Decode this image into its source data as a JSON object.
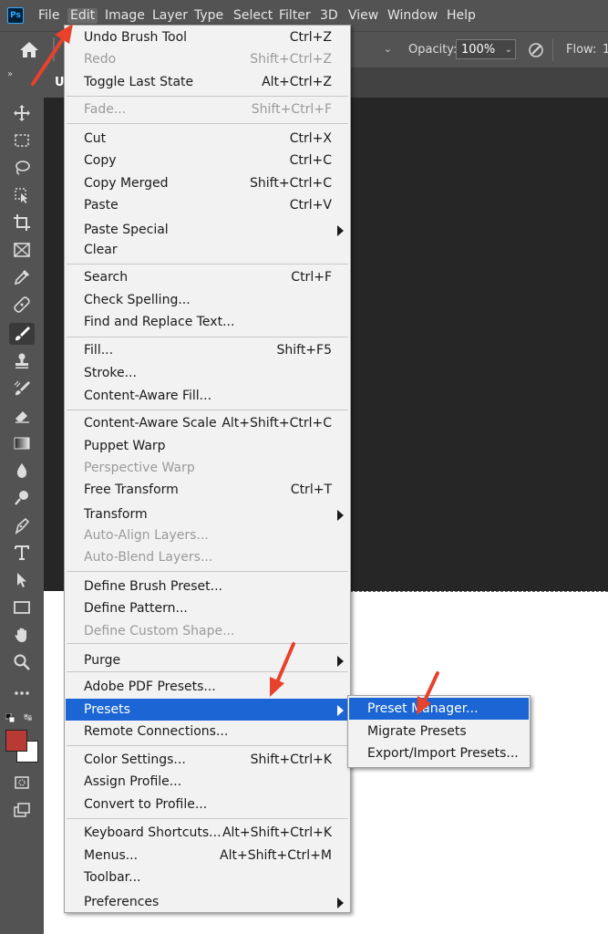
{
  "app": {
    "logo_text": "Ps"
  },
  "menubar": {
    "items": [
      "File",
      "Edit",
      "Image",
      "Layer",
      "Type",
      "Select",
      "Filter",
      "3D",
      "View",
      "Window",
      "Help"
    ],
    "active": "Edit"
  },
  "options_bar": {
    "opacity_label": "Opacity:",
    "opacity_value": "100%",
    "flow_label": "Flow:",
    "flow_value": "1"
  },
  "toolbar": {
    "collapse_glyph": "»"
  },
  "document": {
    "tab_initial": "U"
  },
  "edit_menu": {
    "items": [
      {
        "label": "Undo Brush Tool",
        "shortcut": "Ctrl+Z",
        "disabled": false
      },
      {
        "label": "Redo",
        "shortcut": "Shift+Ctrl+Z",
        "disabled": true
      },
      {
        "label": "Toggle Last State",
        "shortcut": "Alt+Ctrl+Z",
        "disabled": false
      },
      {
        "label": "Fade...",
        "shortcut": "Shift+Ctrl+F",
        "disabled": true
      },
      {
        "label": "Cut",
        "shortcut": "Ctrl+X",
        "disabled": false
      },
      {
        "label": "Copy",
        "shortcut": "Ctrl+C",
        "disabled": false
      },
      {
        "label": "Copy Merged",
        "shortcut": "Shift+Ctrl+C",
        "disabled": false
      },
      {
        "label": "Paste",
        "shortcut": "Ctrl+V",
        "disabled": false
      },
      {
        "label": "Paste Special",
        "shortcut": "",
        "disabled": false,
        "submenu": true
      },
      {
        "label": "Clear",
        "shortcut": "",
        "disabled": false
      },
      {
        "label": "Search",
        "shortcut": "Ctrl+F",
        "disabled": false
      },
      {
        "label": "Check Spelling...",
        "shortcut": "",
        "disabled": false
      },
      {
        "label": "Find and Replace Text...",
        "shortcut": "",
        "disabled": false
      },
      {
        "label": "Fill...",
        "shortcut": "Shift+F5",
        "disabled": false
      },
      {
        "label": "Stroke...",
        "shortcut": "",
        "disabled": false
      },
      {
        "label": "Content-Aware Fill...",
        "shortcut": "",
        "disabled": false
      },
      {
        "label": "Content-Aware Scale",
        "shortcut": "Alt+Shift+Ctrl+C",
        "disabled": false
      },
      {
        "label": "Puppet Warp",
        "shortcut": "",
        "disabled": false
      },
      {
        "label": "Perspective Warp",
        "shortcut": "",
        "disabled": true
      },
      {
        "label": "Free Transform",
        "shortcut": "Ctrl+T",
        "disabled": false
      },
      {
        "label": "Transform",
        "shortcut": "",
        "disabled": false,
        "submenu": true
      },
      {
        "label": "Auto-Align Layers...",
        "shortcut": "",
        "disabled": true
      },
      {
        "label": "Auto-Blend Layers...",
        "shortcut": "",
        "disabled": true
      },
      {
        "label": "Define Brush Preset...",
        "shortcut": "",
        "disabled": false
      },
      {
        "label": "Define Pattern...",
        "shortcut": "",
        "disabled": false
      },
      {
        "label": "Define Custom Shape...",
        "shortcut": "",
        "disabled": true
      },
      {
        "label": "Purge",
        "shortcut": "",
        "disabled": false,
        "submenu": true
      },
      {
        "label": "Adobe PDF Presets...",
        "shortcut": "",
        "disabled": false
      },
      {
        "label": "Presets",
        "shortcut": "",
        "disabled": false,
        "submenu": true,
        "highlighted": true
      },
      {
        "label": "Remote Connections...",
        "shortcut": "",
        "disabled": false
      },
      {
        "label": "Color Settings...",
        "shortcut": "Shift+Ctrl+K",
        "disabled": false
      },
      {
        "label": "Assign Profile...",
        "shortcut": "",
        "disabled": false
      },
      {
        "label": "Convert to Profile...",
        "shortcut": "",
        "disabled": false
      },
      {
        "label": "Keyboard Shortcuts...",
        "shortcut": "Alt+Shift+Ctrl+K",
        "disabled": false
      },
      {
        "label": "Menus...",
        "shortcut": "Alt+Shift+Ctrl+M",
        "disabled": false
      },
      {
        "label": "Toolbar...",
        "shortcut": "",
        "disabled": false
      },
      {
        "label": "Preferences",
        "shortcut": "",
        "disabled": false,
        "submenu": true
      }
    ]
  },
  "presets_submenu": {
    "items": [
      {
        "label": "Preset Manager...",
        "highlighted": true
      },
      {
        "label": "Migrate Presets",
        "highlighted": false
      },
      {
        "label": "Export/Import Presets...",
        "highlighted": false
      }
    ]
  },
  "colors": {
    "foreground": "#b83a35",
    "background": "#ffffff",
    "menu_highlight": "#1b66d4",
    "annotation_arrow": "#e8412c"
  }
}
